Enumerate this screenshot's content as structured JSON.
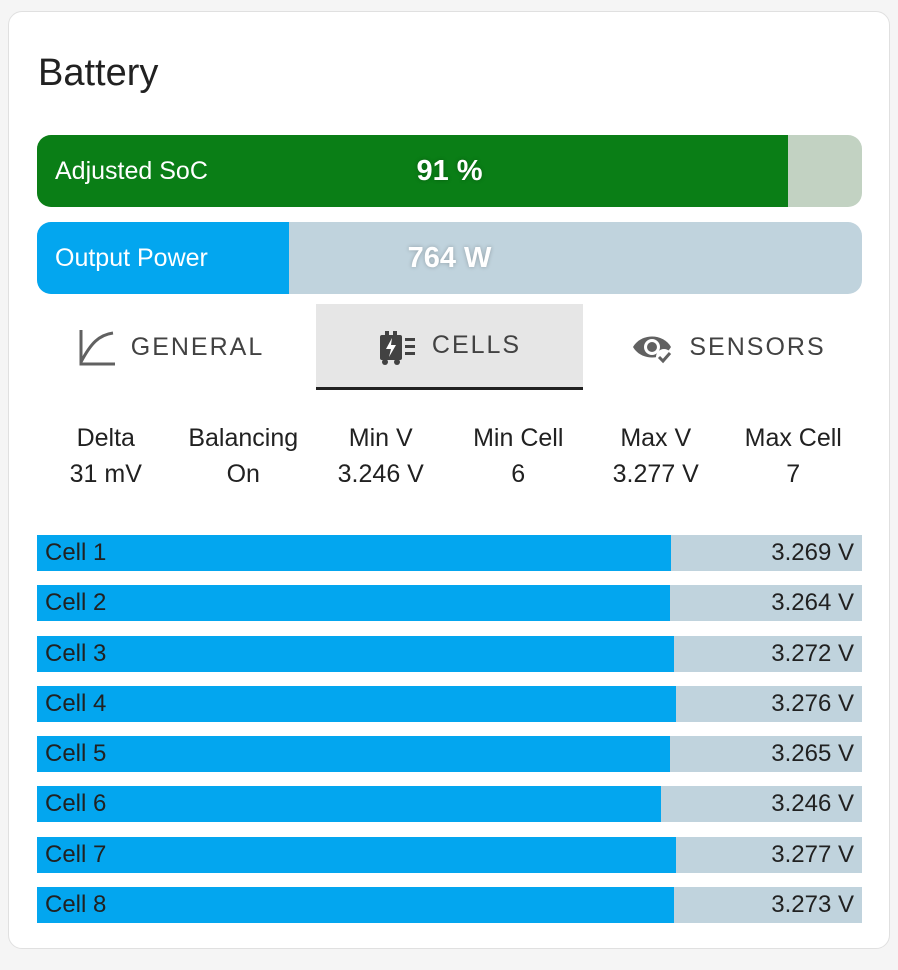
{
  "card": {
    "title": "Battery",
    "soc_bar": {
      "label": "Adjusted SoC",
      "value_text": "91 %",
      "level_percent": 91
    },
    "power_bar": {
      "label": "Output Power",
      "value_text": "764 W",
      "level_percent": 30.5
    }
  },
  "tabs": [
    {
      "label": "GENERAL",
      "icon": "chart-line-icon",
      "active": false
    },
    {
      "label": "CELLS",
      "icon": "battery-charging-cells-icon",
      "active": true
    },
    {
      "label": "SENSORS",
      "icon": "eye-check-icon",
      "active": false
    }
  ],
  "stats": [
    {
      "label": "Delta",
      "value": "31 mV"
    },
    {
      "label": "Balancing",
      "value": "On"
    },
    {
      "label": "Min V",
      "value": "3.246 V"
    },
    {
      "label": "Min Cell",
      "value": "6"
    },
    {
      "label": "Max V",
      "value": "3.277 V"
    },
    {
      "label": "Max Cell",
      "value": "7"
    }
  ],
  "cells": [
    {
      "name": "Cell 1",
      "value": "3.269 V",
      "level_percent": 76.9
    },
    {
      "name": "Cell 2",
      "value": "3.264 V",
      "level_percent": 76.7
    },
    {
      "name": "Cell 3",
      "value": "3.272 V",
      "level_percent": 77.2
    },
    {
      "name": "Cell 4",
      "value": "3.276 V",
      "level_percent": 77.5
    },
    {
      "name": "Cell 5",
      "value": "3.265 V",
      "level_percent": 76.7
    },
    {
      "name": "Cell 6",
      "value": "3.246 V",
      "level_percent": 75.6
    },
    {
      "name": "Cell 7",
      "value": "3.277 V",
      "level_percent": 77.5
    },
    {
      "name": "Cell 8",
      "value": "3.273 V",
      "level_percent": 77.2
    }
  ],
  "colors": {
    "soc_fill": "#0a7e16",
    "soc_track": "#c2d2c2",
    "accent_blue": "#03a6ef",
    "track_blue": "#c0d3dd"
  }
}
